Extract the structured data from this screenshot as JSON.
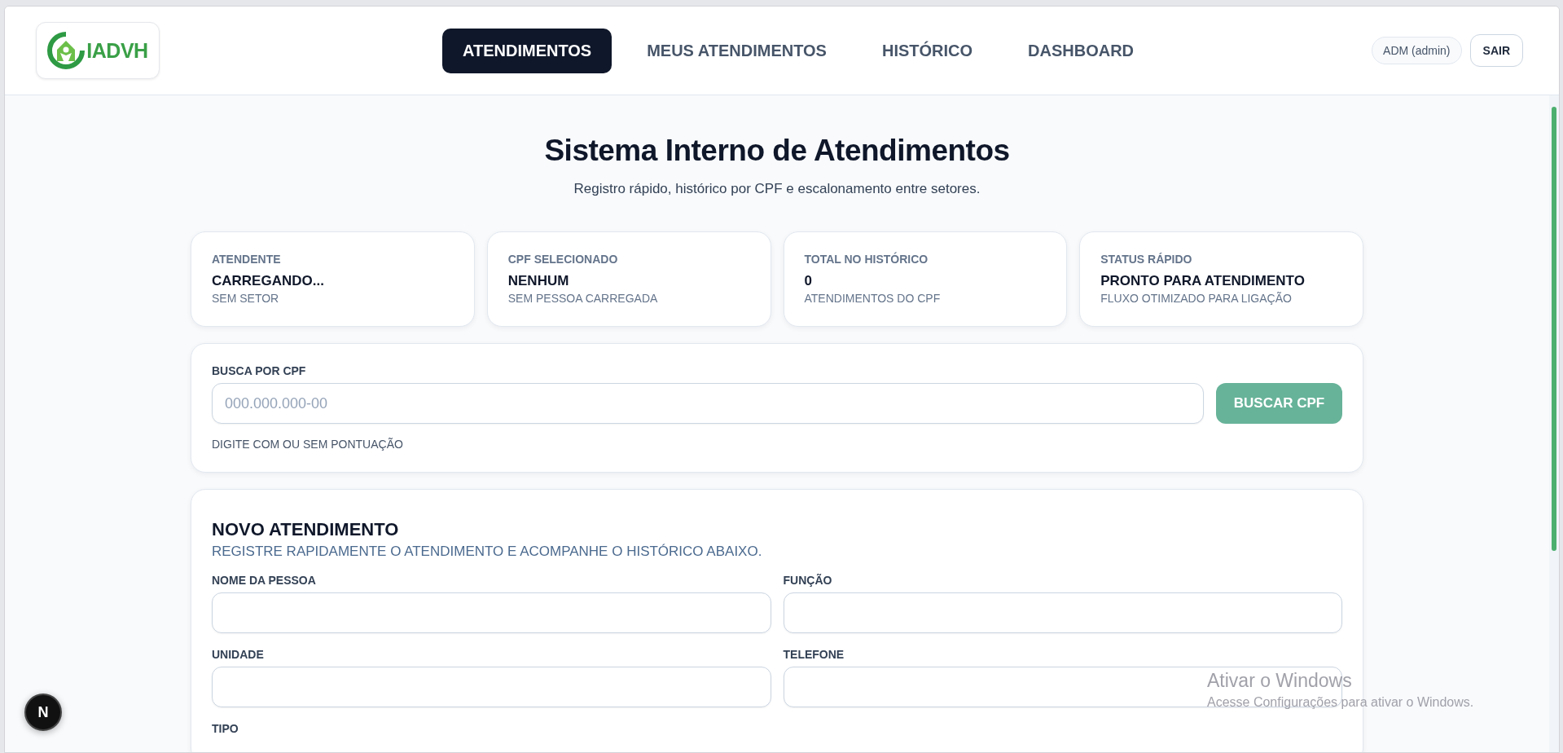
{
  "header": {
    "logo": {
      "text": "IADVH"
    },
    "nav": [
      {
        "label": "ATENDIMENTOS",
        "selected": true
      },
      {
        "label": "MEUS ATENDIMENTOS",
        "selected": false
      },
      {
        "label": "HISTÓRICO",
        "selected": false
      },
      {
        "label": "DASHBOARD",
        "selected": false
      }
    ],
    "user": "ADM (admin)",
    "logout": "SAIR"
  },
  "title": "Sistema Interno de Atendimentos",
  "subtitle": "Registro rápido, histórico por CPF e escalonamento entre setores.",
  "stats": [
    {
      "label": "ATENDENTE",
      "value": "CARREGANDO...",
      "note": "SEM SETOR"
    },
    {
      "label": "CPF SELECIONADO",
      "value": "NENHUM",
      "note": "SEM PESSOA CARREGADA"
    },
    {
      "label": "TOTAL NO HISTÓRICO",
      "value": "0",
      "note": "ATENDIMENTOS DO CPF"
    },
    {
      "label": "STATUS RÁPIDO",
      "value": "PRONTO PARA ATENDIMENTO",
      "note": "FLUXO OTIMIZADO PARA LIGAÇÃO"
    }
  ],
  "search": {
    "label": "BUSCA POR CPF",
    "placeholder": "000.000.000-00",
    "button": "BUSCAR CPF",
    "hint": "DIGITE COM OU SEM PONTUAÇÃO"
  },
  "form": {
    "title": "NOVO ATENDIMENTO",
    "subtitle": "REGISTRE RAPIDAMENTE O ATENDIMENTO E ACOMPANHE O HISTÓRICO ABAIXO.",
    "fields": [
      {
        "label": "NOME DA PESSOA"
      },
      {
        "label": "FUNÇÃO"
      },
      {
        "label": "UNIDADE"
      },
      {
        "label": "TELEFONE"
      }
    ],
    "next_label": "TIPO"
  },
  "dev_badge": "N",
  "os_notice": {
    "title": "Ativar o Windows",
    "text": "Acesse Configurações para ativar o Windows."
  }
}
